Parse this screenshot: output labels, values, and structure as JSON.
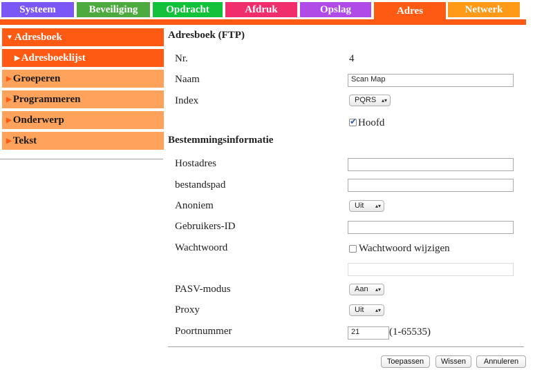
{
  "colors": {
    "tab_systeem": "#7b57f5",
    "tab_beveiliging": "#4caa3e",
    "tab_opdracht": "#12c23a",
    "tab_afdruk": "#f02e6e",
    "tab_opslag": "#b14be8",
    "tab_adres": "#ff5a14",
    "tab_netwerk": "#ff9a18",
    "sidebar_active": "#ff5a14",
    "sidebar_item": "#ffa35c"
  },
  "tabs": {
    "systeem": "Systeem",
    "beveiliging": "Beveiliging",
    "opdracht": "Opdracht",
    "afdruk": "Afdruk",
    "opslag": "Opslag",
    "adres": "Adres",
    "netwerk": "Netwerk"
  },
  "sidebar": {
    "adresboek": "Adresboek",
    "adresboeklijst": "Adresboeklijst",
    "groeperen": "Groeperen",
    "programmeren": "Programmeren",
    "onderwerp": "Onderwerp",
    "tekst": "Tekst"
  },
  "form": {
    "title": "Adresboek (FTP)",
    "nr_label": "Nr.",
    "nr_value": "4",
    "naam_label": "Naam",
    "naam_value": "Scan Map",
    "index_label": "Index",
    "index_value": "PQRS",
    "hoofd_label": "Hoofd",
    "dest_title": "Bestemmingsinformatie",
    "hostadres_label": "Hostadres",
    "hostadres_value": "",
    "bestandspad_label": "bestandspad",
    "bestandspad_value": "",
    "anoniem_label": "Anoniem",
    "anoniem_value": "Uit",
    "gebruikers_label": "Gebruikers-ID",
    "gebruikers_value": "",
    "wachtwoord_label": "Wachtwoord",
    "wachtwoord_wijzigen_label": "Wachtwoord wijzigen",
    "wachtwoord_value": "",
    "pasv_label": "PASV-modus",
    "pasv_value": "Aan",
    "proxy_label": "Proxy",
    "proxy_value": "Uit",
    "poort_label": "Poortnummer",
    "poort_value": "21",
    "poort_range": "(1-65535)"
  },
  "buttons": {
    "toepassen": "Toepassen",
    "wissen": "Wissen",
    "annuleren": "Annuleren"
  }
}
